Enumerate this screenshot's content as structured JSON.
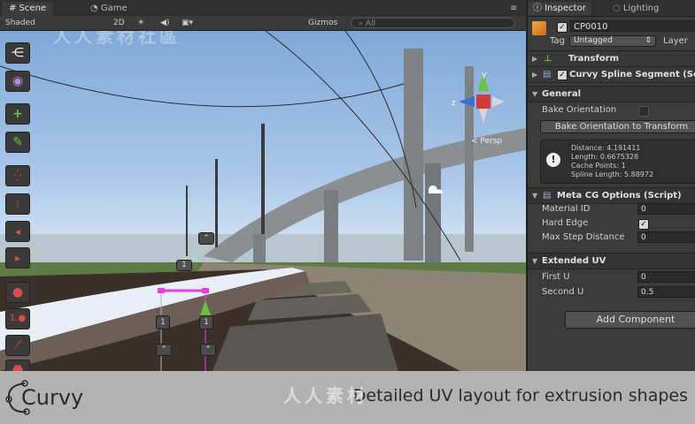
{
  "scene_tabs": [
    {
      "label": "Scene",
      "icon": "hash-icon"
    },
    {
      "label": "Game",
      "icon": "pacman-icon"
    }
  ],
  "toolbar": {
    "shading": "Shaded",
    "mode_2d": "2D",
    "gizmos": "Gizmos",
    "search_placeholder": "All"
  },
  "scene": {
    "persp_label": "< Persp",
    "handle_labels": [
      "1",
      "1",
      "1"
    ]
  },
  "tools": [
    {
      "name": "hierarchy-icon"
    },
    {
      "name": "eye-icon"
    },
    {
      "name": "add-icon"
    },
    {
      "name": "pencil-icon"
    },
    {
      "name": "dots-icon"
    },
    {
      "name": "dots-vertical-icon"
    },
    {
      "name": "arrow-left-icon"
    },
    {
      "name": "arrow-right-icon"
    },
    {
      "name": "sphere-icon"
    },
    {
      "name": "numbered-sphere-icon"
    },
    {
      "name": "curve-icon"
    },
    {
      "name": "stop-icon"
    }
  ],
  "inspector": {
    "tabs": [
      "Inspector",
      "Lighting"
    ],
    "object_name": "CP0010",
    "tag_label": "Tag",
    "tag_value": "Untagged",
    "layer_label": "Layer",
    "components": {
      "transform": "Transform",
      "segment": "Curvy Spline Segment (Script)"
    },
    "general": {
      "header": "General",
      "bake_orientation_label": "Bake Orientation",
      "bake_button": "Bake Orientation to Transform",
      "info": [
        "Distance: 4.191411",
        "Length: 0.6675328",
        "Cache Points: 1",
        "Spline Length: 5.88972"
      ]
    },
    "meta": {
      "header": "Meta CG Options (Script)",
      "material_id_label": "Material ID",
      "material_id_value": "0",
      "hard_edge_label": "Hard Edge",
      "max_step_label": "Max Step Distance",
      "max_step_value": "0"
    },
    "extended_uv": {
      "header": "Extended UV",
      "first_u_label": "First U",
      "first_u_value": "0",
      "second_u_label": "Second U",
      "second_u_value": "0.5"
    },
    "add_component": "Add Component"
  },
  "banner": {
    "brand": "Curvy",
    "tagline": "Detailed UV layout for extrusion shapes"
  },
  "colors": {
    "inspector_bg": "#3b3b3b",
    "selection_magenta": "#e040e0",
    "gizmo_red": "#d03b3b",
    "gizmo_green": "#69c23a",
    "gizmo_blue": "#3b6fd0"
  }
}
